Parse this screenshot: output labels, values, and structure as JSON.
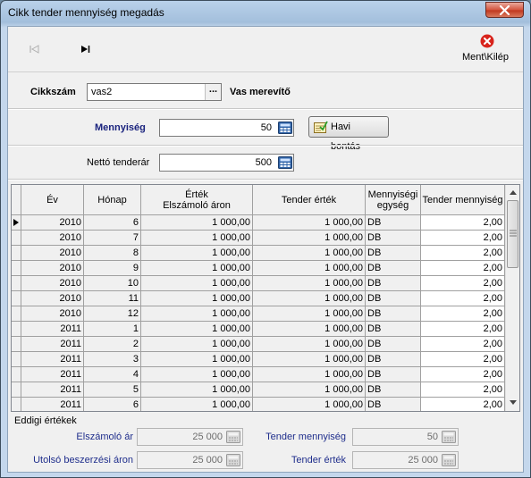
{
  "window": {
    "title": "Cikk tender mennyiség megadás"
  },
  "toolbar": {
    "exit_label": "Ment\\Kilép"
  },
  "form": {
    "cikkszam_label": "Cikkszám",
    "cikkszam_value": "vas2",
    "cikkszam_lookup": "...",
    "cikk_name": "Vas merevítő",
    "mennyiseg_label": "Mennyiség",
    "mennyiseg_value": "50",
    "havi_bontas_label": "Havi bontás",
    "netto_label": "Nettó tenderár",
    "netto_value": "500"
  },
  "table": {
    "headers": {
      "ev": "Év",
      "honap": "Hónap",
      "ertek": "Érték\nElszámoló áron",
      "tender_ertek": "Tender érték",
      "mennyisegi_egyseg": "Mennyiségi\negység",
      "tender_mennyiseg": "Tender mennyiség"
    },
    "rows": [
      {
        "ev": "2010",
        "honap": "6",
        "ertek": "1 000,00",
        "tender_ertek": "1 000,00",
        "egyseg": "DB",
        "tender_mennyiseg": "2,00"
      },
      {
        "ev": "2010",
        "honap": "7",
        "ertek": "1 000,00",
        "tender_ertek": "1 000,00",
        "egyseg": "DB",
        "tender_mennyiseg": "2,00"
      },
      {
        "ev": "2010",
        "honap": "8",
        "ertek": "1 000,00",
        "tender_ertek": "1 000,00",
        "egyseg": "DB",
        "tender_mennyiseg": "2,00"
      },
      {
        "ev": "2010",
        "honap": "9",
        "ertek": "1 000,00",
        "tender_ertek": "1 000,00",
        "egyseg": "DB",
        "tender_mennyiseg": "2,00"
      },
      {
        "ev": "2010",
        "honap": "10",
        "ertek": "1 000,00",
        "tender_ertek": "1 000,00",
        "egyseg": "DB",
        "tender_mennyiseg": "2,00"
      },
      {
        "ev": "2010",
        "honap": "11",
        "ertek": "1 000,00",
        "tender_ertek": "1 000,00",
        "egyseg": "DB",
        "tender_mennyiseg": "2,00"
      },
      {
        "ev": "2010",
        "honap": "12",
        "ertek": "1 000,00",
        "tender_ertek": "1 000,00",
        "egyseg": "DB",
        "tender_mennyiseg": "2,00"
      },
      {
        "ev": "2011",
        "honap": "1",
        "ertek": "1 000,00",
        "tender_ertek": "1 000,00",
        "egyseg": "DB",
        "tender_mennyiseg": "2,00"
      },
      {
        "ev": "2011",
        "honap": "2",
        "ertek": "1 000,00",
        "tender_ertek": "1 000,00",
        "egyseg": "DB",
        "tender_mennyiseg": "2,00"
      },
      {
        "ev": "2011",
        "honap": "3",
        "ertek": "1 000,00",
        "tender_ertek": "1 000,00",
        "egyseg": "DB",
        "tender_mennyiseg": "2,00"
      },
      {
        "ev": "2011",
        "honap": "4",
        "ertek": "1 000,00",
        "tender_ertek": "1 000,00",
        "egyseg": "DB",
        "tender_mennyiseg": "2,00"
      },
      {
        "ev": "2011",
        "honap": "5",
        "ertek": "1 000,00",
        "tender_ertek": "1 000,00",
        "egyseg": "DB",
        "tender_mennyiseg": "2,00"
      },
      {
        "ev": "2011",
        "honap": "6",
        "ertek": "1 000,00",
        "tender_ertek": "1 000,00",
        "egyseg": "DB",
        "tender_mennyiseg": "2,00"
      }
    ]
  },
  "summary": {
    "title": "Eddigi értékek",
    "elszamolo_ar_label": "Elszámoló ár",
    "elszamolo_ar_value": "25 000",
    "utolso_beszerzesi_label": "Utolsó beszerzési áron",
    "utolso_beszerzesi_value": "25 000",
    "tender_mennyiseg_label": "Tender mennyiség",
    "tender_mennyiseg_value": "50",
    "tender_ertek_label": "Tender érték",
    "tender_ertek_value": "25 000"
  },
  "colors": {
    "label_blue": "#1f2e8c",
    "mennyiseg_label": "#1a237e"
  }
}
